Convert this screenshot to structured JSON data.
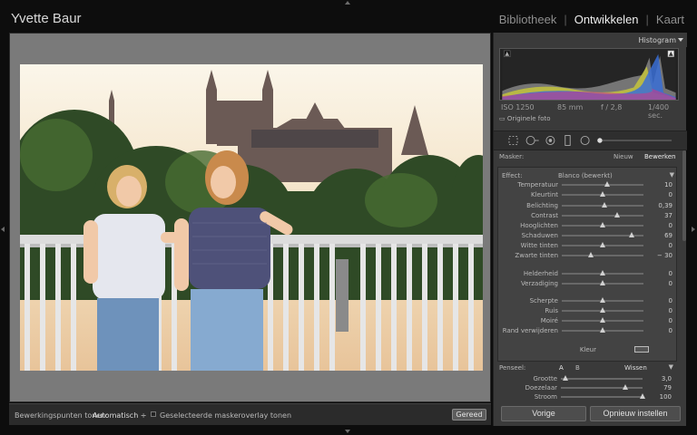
{
  "app": {
    "identity_plate": "Yvette Baur",
    "modules": [
      "Bibliotheek",
      "Ontwikkelen",
      "Kaart"
    ],
    "active_module": "Ontwikkelen"
  },
  "histogram": {
    "title": "Histogram",
    "iso": "ISO 1250",
    "focal": "85 mm",
    "aperture": "f / 2,8",
    "shutter": "1/400 sec.",
    "original_label": "Originele foto"
  },
  "mask": {
    "label": "Masker:",
    "new_label": "Nieuw",
    "edit_label": "Bewerken",
    "effect_label": "Effect:",
    "effect_value": "Blanco (bewerkt)"
  },
  "sliders": [
    {
      "name": "Temperatuur",
      "value": "10",
      "pos": 0.55
    },
    {
      "name": "Kleurtint",
      "value": "0",
      "pos": 0.5
    },
    {
      "name": "Belichting",
      "value": "0,39",
      "pos": 0.52
    },
    {
      "name": "Contrast",
      "value": "37",
      "pos": 0.68
    },
    {
      "name": "Hooglichten",
      "value": "0",
      "pos": 0.5
    },
    {
      "name": "Schaduwen",
      "value": "69",
      "pos": 0.85
    },
    {
      "name": "Witte tinten",
      "value": "0",
      "pos": 0.5
    },
    {
      "name": "Zwarte tinten",
      "value": "− 30",
      "pos": 0.35
    },
    {
      "name": "Helderheid",
      "value": "0",
      "pos": 0.5
    },
    {
      "name": "Verzadiging",
      "value": "0",
      "pos": 0.5
    },
    {
      "name": "Scherpte",
      "value": "0",
      "pos": 0.5
    },
    {
      "name": "Ruis",
      "value": "0",
      "pos": 0.5
    },
    {
      "name": "Moiré",
      "value": "0",
      "pos": 0.5
    },
    {
      "name": "Rand verwijderen",
      "value": "0",
      "pos": 0.5
    }
  ],
  "color_label": "Kleur",
  "brush": {
    "label": "Penseel:",
    "a": "A",
    "b": "B",
    "erase": "Wissen",
    "rows": [
      {
        "name": "Grootte",
        "value": "3,0",
        "pos": 0.05
      },
      {
        "name": "Doezelaar",
        "value": "79",
        "pos": 0.79
      },
      {
        "name": "Stroom",
        "value": "100",
        "pos": 1.0
      }
    ]
  },
  "buttons": {
    "previous": "Vorige",
    "reset": "Opnieuw instellen",
    "done": "Gereed"
  },
  "toolbar": {
    "pins_label": "Bewerkingspunten tonen:",
    "pins_value": "Automatisch ÷",
    "overlay_label": "Geselecteerde maskeroverlay tonen"
  },
  "colors": {
    "accent": "#eeeeee",
    "panel": "#3a3a3a",
    "canvas": "#7a7a7a"
  }
}
